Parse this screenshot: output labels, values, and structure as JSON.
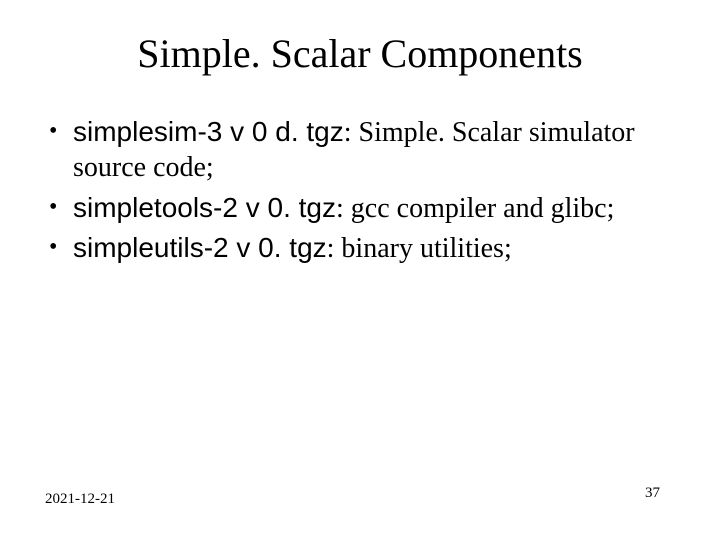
{
  "title": "Simple. Scalar Components",
  "bullets": [
    {
      "pkg": "simplesim-3 v 0 d. tgz",
      "sep": ": ",
      "desc": "Simple. Scalar simulator source code;"
    },
    {
      "pkg": "simpletools-2 v 0. tgz",
      "sep": ": ",
      "desc": "gcc compiler and glibc;"
    },
    {
      "pkg": "simpleutils-2 v 0. tgz",
      "sep": ": ",
      "desc": "binary utilities;"
    }
  ],
  "footer": {
    "date": "2021-12-21",
    "page": "37"
  }
}
